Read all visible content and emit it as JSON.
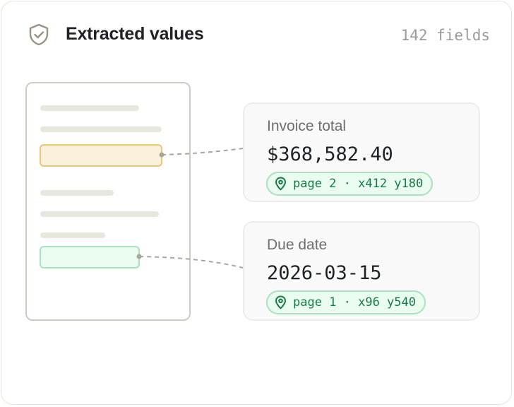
{
  "header": {
    "title": "Extracted values",
    "field_count": "142 fields",
    "icon": "shield-check-icon"
  },
  "fields": [
    {
      "label": "Invoice total",
      "value": "$368,582.40",
      "location": "page 2 · x412 y180",
      "highlight_color": "#e8c775"
    },
    {
      "label": "Due date",
      "value": "2026-03-15",
      "location": "page 1 · x96 y540",
      "highlight_color": "#a8e2bf"
    }
  ],
  "colors": {
    "location_text": "#177a46",
    "location_border": "#a8e2bf",
    "connector": "#aaa69e"
  }
}
